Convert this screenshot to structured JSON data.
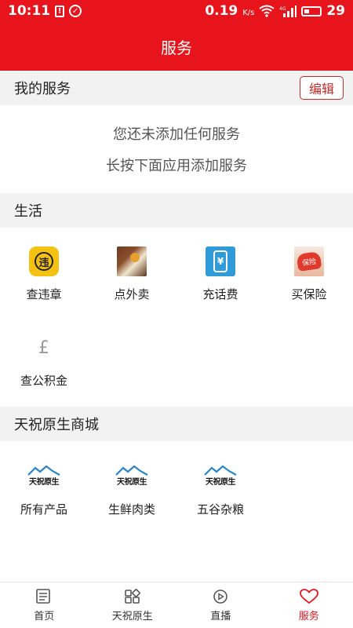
{
  "status_bar": {
    "time": "10:11",
    "net_speed": "0.19",
    "net_unit": "K/s",
    "battery": "29",
    "network_type": "4G"
  },
  "header": {
    "title": "服务"
  },
  "my_services": {
    "title": "我的服务",
    "edit_label": "编辑",
    "empty_line1": "您还未添加任何服务",
    "empty_line2": "长按下面应用添加服务"
  },
  "life": {
    "title": "生活",
    "items": [
      {
        "label": "查违章",
        "icon": "traffic-violation-icon",
        "icon_text": "违"
      },
      {
        "label": "点外卖",
        "icon": "food-delivery-icon"
      },
      {
        "label": "充话费",
        "icon": "phone-recharge-icon",
        "icon_text": "¥"
      },
      {
        "label": "买保险",
        "icon": "insurance-icon",
        "icon_text": "保险"
      },
      {
        "label": "查公积金",
        "icon": "housing-fund-icon",
        "icon_text": "£"
      }
    ]
  },
  "mall": {
    "title": "天祝原生商城",
    "logo_text": "天祝原生",
    "items": [
      {
        "label": "所有产品",
        "icon": "tianzhu-logo-icon"
      },
      {
        "label": "生鲜肉类",
        "icon": "tianzhu-logo-icon"
      },
      {
        "label": "五谷杂粮",
        "icon": "tianzhu-logo-icon"
      }
    ]
  },
  "tabbar": {
    "items": [
      {
        "label": "首页",
        "icon": "home-news-icon"
      },
      {
        "label": "天祝原生",
        "icon": "grid-apps-icon"
      },
      {
        "label": "直播",
        "icon": "live-play-icon"
      },
      {
        "label": "服务",
        "icon": "heart-icon"
      }
    ],
    "active": "服务"
  },
  "colors": {
    "brand_red": "#e8141c",
    "edit_border": "#c62a2a"
  }
}
